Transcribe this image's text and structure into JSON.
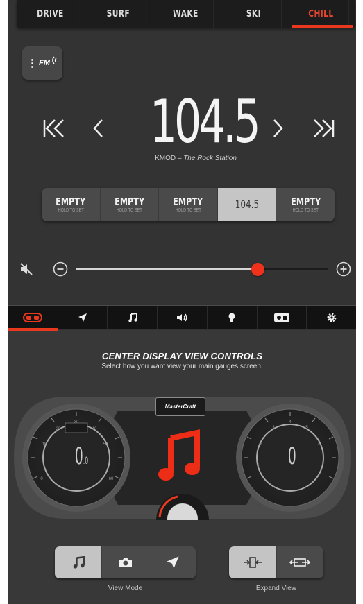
{
  "top_tabs": [
    {
      "label": "DRIVE",
      "active": false
    },
    {
      "label": "SURF",
      "active": false
    },
    {
      "label": "WAKE",
      "active": false
    },
    {
      "label": "SKI",
      "active": false
    },
    {
      "label": "CHILL",
      "active": true
    }
  ],
  "source": {
    "icon": "radio-signal-icon",
    "label": "FM"
  },
  "tuner": {
    "frequency": "104.5",
    "station_call": "KMOD",
    "separator": "–",
    "station_name": "The Rock Station",
    "prev_station_glyph": "K<",
    "seek_back_glyph": "<",
    "seek_forward_glyph": ">",
    "next_station_glyph": ">K"
  },
  "presets": [
    {
      "label": "EMPTY",
      "sub": "HOLD TO SET",
      "selected": false
    },
    {
      "label": "EMPTY",
      "sub": "HOLD TO SET",
      "selected": false
    },
    {
      "label": "EMPTY",
      "sub": "HOLD TO SET",
      "selected": false
    },
    {
      "label": "104.5",
      "sub": "",
      "selected": true
    },
    {
      "label": "EMPTY",
      "sub": "HOLD TO SET",
      "selected": false
    }
  ],
  "volume": {
    "level": 0.72,
    "mute_icon": "speaker-muted-icon",
    "minus_icon": "minus-circle-icon",
    "plus_icon": "plus-circle-icon"
  },
  "mid_tabs": [
    {
      "icon": "display-toggle-icon",
      "active": true
    },
    {
      "icon": "navigation-arrow-icon",
      "active": false
    },
    {
      "icon": "music-note-icon",
      "active": false
    },
    {
      "icon": "speaker-icon",
      "active": false
    },
    {
      "icon": "light-bulb-icon",
      "active": false
    },
    {
      "icon": "camera-display-icon",
      "active": false
    },
    {
      "icon": "gear-icon",
      "active": false
    }
  ],
  "center_display": {
    "title": "CENTER DISPLAY VIEW CONTROLS",
    "subtitle": "Select how you want view your main gauges screen.",
    "logo": "MasterCraft",
    "left_gauge_value": "0",
    "left_gauge_decimal": ".0",
    "right_gauge_value": "0",
    "left_ticks": [
      "20",
      "30",
      "40",
      "50",
      "60",
      "10",
      "0"
    ],
    "right_ticks": [
      "2",
      "3",
      "4",
      "5",
      "6",
      "1",
      "7"
    ],
    "colors": {
      "accent": "#e8381e",
      "panel": "#2b2b2b"
    }
  },
  "view_mode": {
    "label": "View Mode",
    "options": [
      {
        "icon": "music-note-icon",
        "selected": true
      },
      {
        "icon": "camera-icon",
        "selected": false
      },
      {
        "icon": "navigation-arrow-icon",
        "selected": false
      }
    ]
  },
  "expand_view": {
    "label": "Expand View",
    "options": [
      {
        "icon": "collapse-view-icon",
        "selected": true
      },
      {
        "icon": "expand-view-icon",
        "selected": false
      }
    ]
  }
}
